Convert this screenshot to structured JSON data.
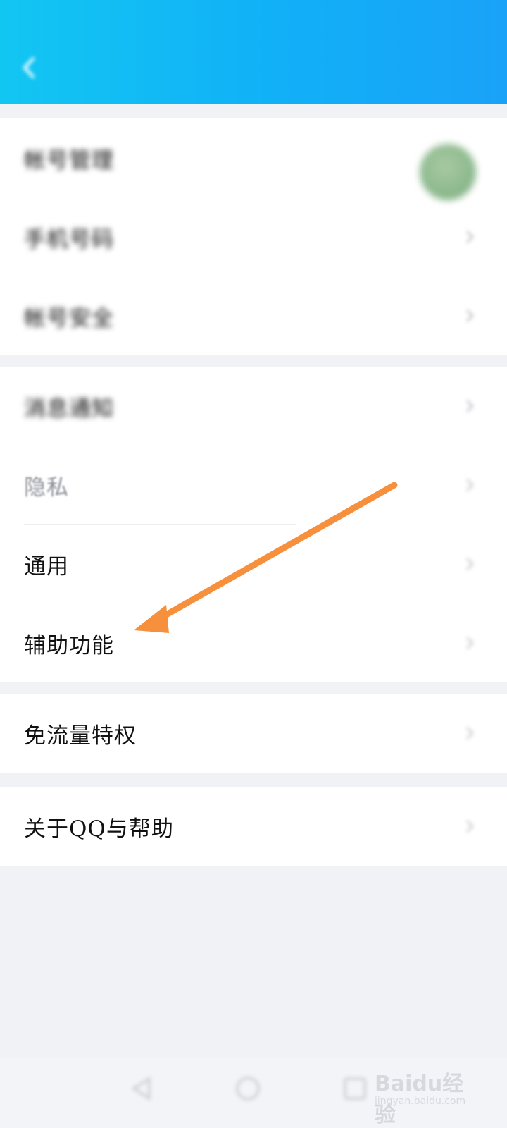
{
  "status_bar": {
    "left": "",
    "right": ""
  },
  "header": {
    "title": ""
  },
  "groups": [
    {
      "rows": [
        {
          "label": "帐号管理"
        },
        {
          "label": "手机号码",
          "value": ""
        },
        {
          "label": "帐号安全"
        }
      ]
    },
    {
      "rows": [
        {
          "label": "消息通知"
        },
        {
          "label": "隐私"
        },
        {
          "label": "通用"
        },
        {
          "label": "辅助功能"
        }
      ]
    },
    {
      "rows": [
        {
          "label": "免流量特权"
        }
      ]
    },
    {
      "rows": [
        {
          "label": "关于QQ与帮助"
        }
      ]
    }
  ],
  "watermark": {
    "logo": "Baidu经验",
    "url": "jingyan.baidu.com"
  },
  "colors": {
    "header": "#11b0f7",
    "arrow": "#f7903c",
    "background": "#f1f2f6"
  },
  "icons": [
    "back-arrow-icon",
    "chevron-right-icon",
    "avatar",
    "nav-back-icon",
    "nav-home-icon",
    "nav-recent-icon"
  ]
}
